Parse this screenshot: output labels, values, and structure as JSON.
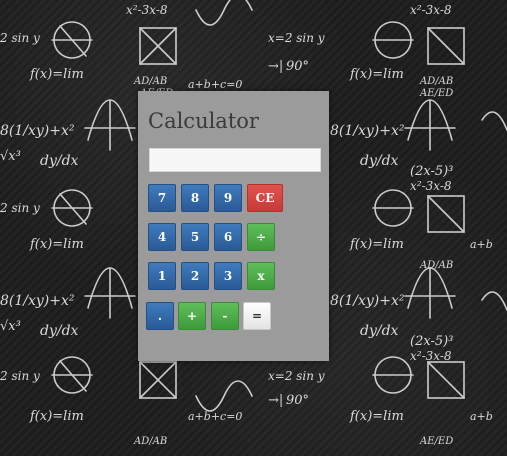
{
  "calculator": {
    "title": "Calculator",
    "display_value": "",
    "keys": {
      "seven": "7",
      "eight": "8",
      "nine": "9",
      "clear": "CE",
      "four": "4",
      "five": "5",
      "six": "6",
      "divide": "÷",
      "one": "1",
      "two": "2",
      "three": "3",
      "multiply": "x",
      "decimal": ".",
      "add": "+",
      "subtract": "-",
      "equals": "="
    }
  },
  "background": {
    "formulas": [
      "f(x) = lim",
      "x = 2 sin y",
      "AD/AB",
      "AE/ED",
      "dy/dx",
      "(2x - 5)³",
      "x² - 3x - 8",
      "90°",
      "√x³"
    ]
  },
  "colors": {
    "panel": "#9b9b9b",
    "key_blue": "#2f66a6",
    "key_green": "#4aab46",
    "key_red": "#d1443f",
    "key_white": "#f2f2f2"
  }
}
